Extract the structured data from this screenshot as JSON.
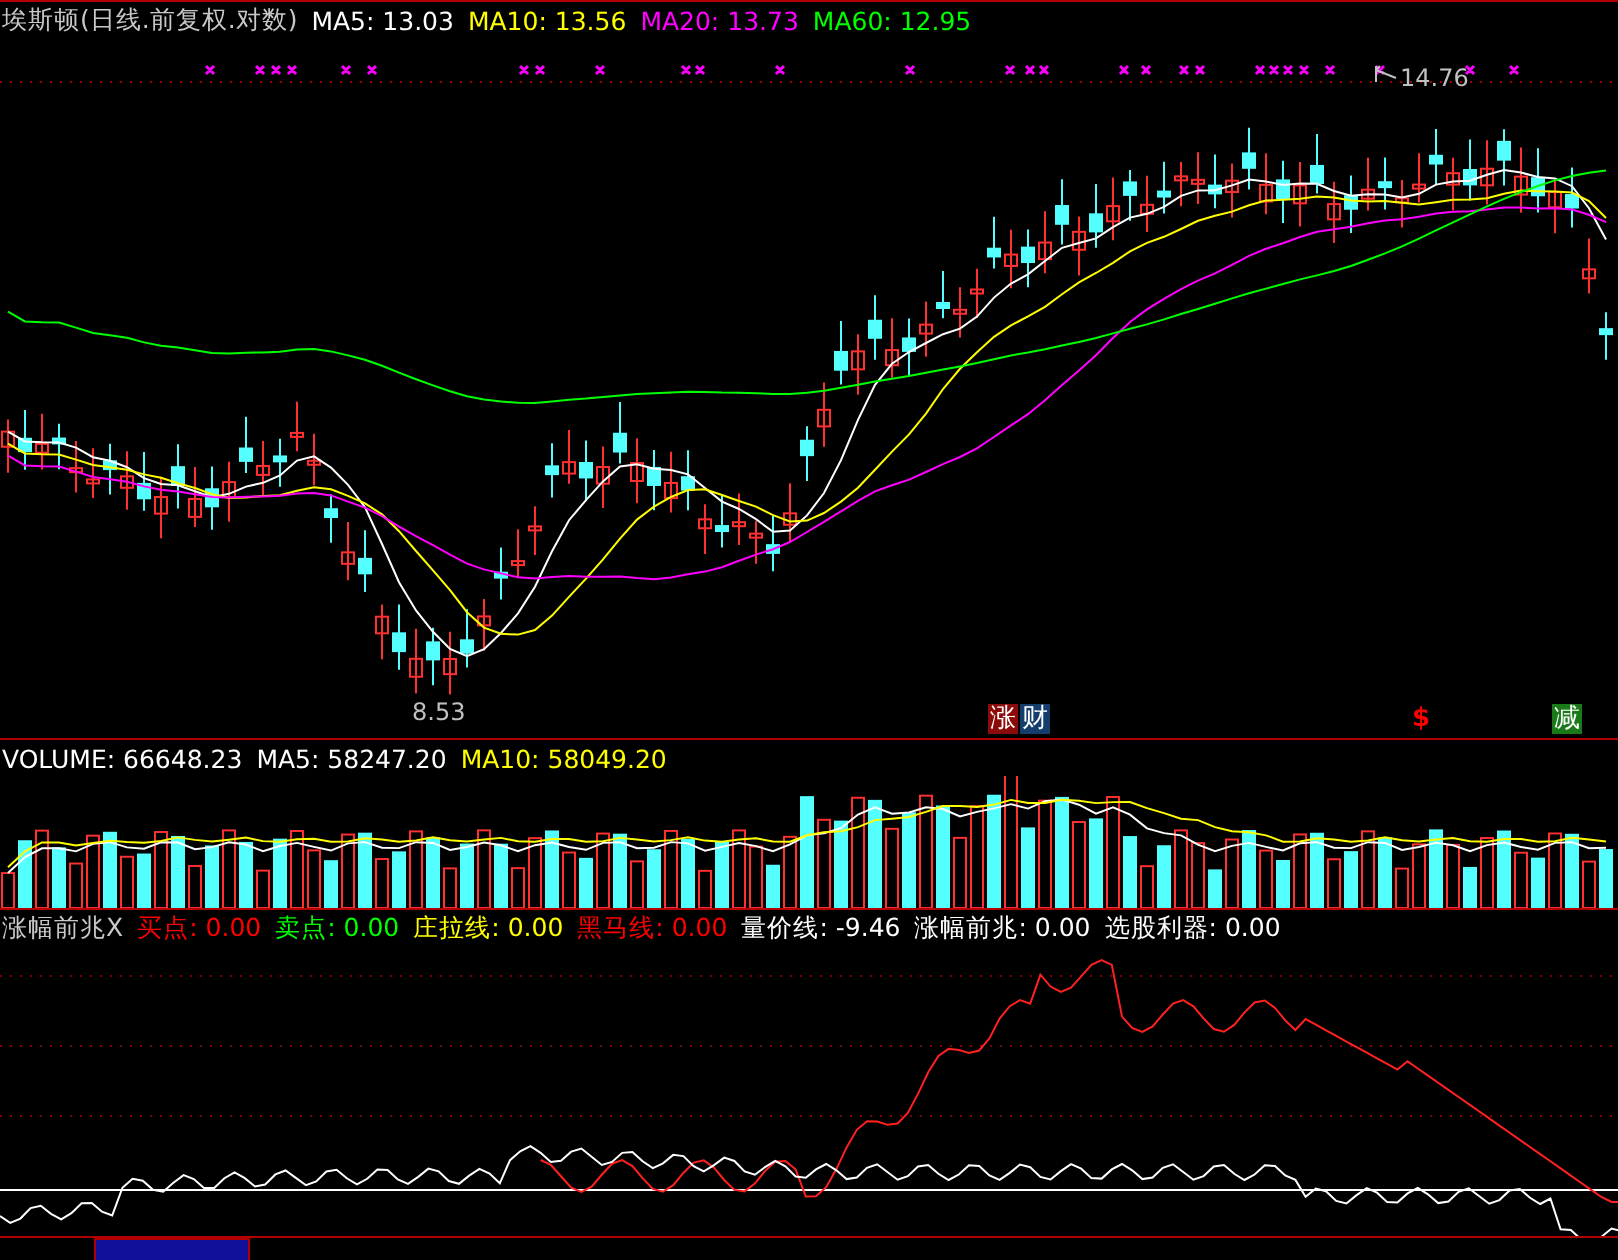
{
  "main_panel": {
    "title": "埃斯顿(日线.前复权.对数)",
    "indicators": [
      {
        "label": "MA5: 13.03",
        "color": "#ffffff"
      },
      {
        "label": "MA10: 13.56",
        "color": "#ffff00"
      },
      {
        "label": "MA20: 13.73",
        "color": "#ff00ff"
      },
      {
        "label": "MA60: 12.95",
        "color": "#00ff00"
      }
    ],
    "high_label": "14.76",
    "low_label": "8.53",
    "signals": [
      {
        "text": "涨",
        "kind": "tag",
        "color": "#8b0a0a"
      },
      {
        "text": "财",
        "kind": "tag",
        "color": "#153d6b"
      },
      {
        "text": "$",
        "kind": "sign",
        "color": "#ff0000"
      },
      {
        "text": "减",
        "kind": "tag",
        "color": "#1a7a1a"
      }
    ]
  },
  "volume_panel": {
    "indicators": [
      {
        "label": "VOLUME: 66648.23",
        "color": "#ffffff"
      },
      {
        "label": "MA5: 58247.20",
        "color": "#ffffff"
      },
      {
        "label": "MA10: 58049.20",
        "color": "#ffff00"
      }
    ]
  },
  "indicator_panel": {
    "title": "涨幅前兆X",
    "indicators": [
      {
        "label": "买点: 0.00",
        "color": "#ff0000"
      },
      {
        "label": "卖点: 0.00",
        "color": "#00ff00"
      },
      {
        "label": "庄拉线: 0.00",
        "color": "#ffff00"
      },
      {
        "label": "黑马线: 0.00",
        "color": "#ff0000"
      },
      {
        "label": "量价线: -9.46",
        "color": "#ffffff"
      },
      {
        "label": "涨幅前兆: 0.00",
        "color": "#ffffff"
      },
      {
        "label": "选股利器: 0.00",
        "color": "#ffffff"
      }
    ]
  }
}
